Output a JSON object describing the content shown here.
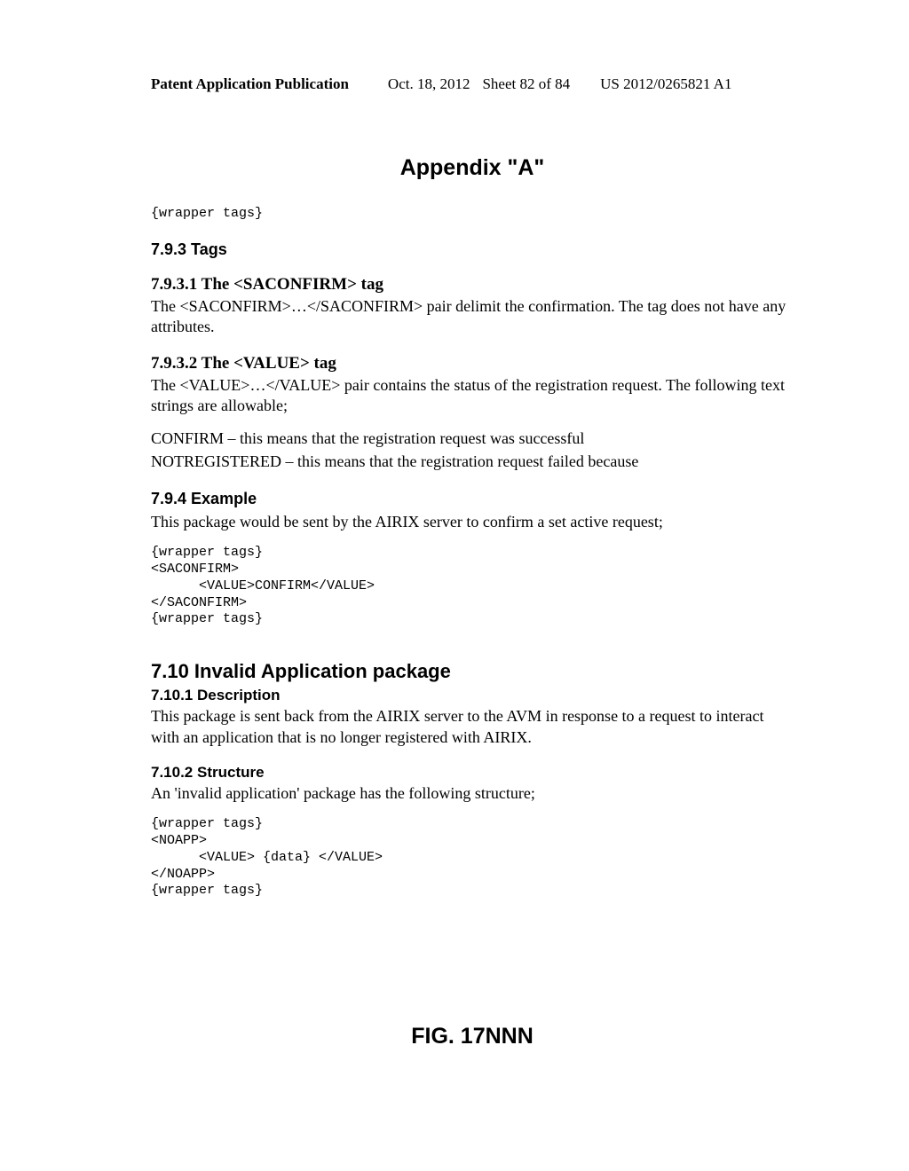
{
  "header": {
    "publication": "Patent Application Publication",
    "date": "Oct. 18, 2012",
    "sheet": "Sheet 82 of 84",
    "pubno": "US 2012/0265821 A1"
  },
  "appendix_title": "Appendix \"A\"",
  "wrapper_tags_line": "{wrapper tags}",
  "s793": {
    "heading": "7.9.3   Tags"
  },
  "s7931": {
    "heading": "7.9.3.1  The <SACONFIRM> tag",
    "body": "The <SACONFIRM>…</SACONFIRM> pair delimit the confirmation. The tag does not have any attributes."
  },
  "s7932": {
    "heading": "7.9.3.2  The <VALUE> tag",
    "body1": "The <VALUE>…</VALUE> pair contains the status of the registration request. The following text strings are allowable;",
    "body2": "CONFIRM – this means that the registration request was successful",
    "body3": "NOTREGISTERED – this means that the registration request failed because"
  },
  "s794": {
    "heading": "7.9.4   Example",
    "body": "This package would be sent by the AIRIX server to confirm a set active request;",
    "code": "{wrapper tags}\n<SACONFIRM>\n      <VALUE>CONFIRM</VALUE>\n</SACONFIRM>\n{wrapper tags}"
  },
  "s710": {
    "heading": "7.10 Invalid Application package"
  },
  "s7101": {
    "heading": "7.10.1 Description",
    "body": "This package is sent back from the AIRIX server to the AVM in response to a request to interact with an application that is no longer registered with AIRIX."
  },
  "s7102": {
    "heading": "7.10.2 Structure",
    "body": "An 'invalid application' package has the following structure;",
    "code": "{wrapper tags}\n<NOAPP>\n      <VALUE> {data} </VALUE>\n</NOAPP>\n{wrapper tags}"
  },
  "figure_caption": "FIG. 17NNN"
}
